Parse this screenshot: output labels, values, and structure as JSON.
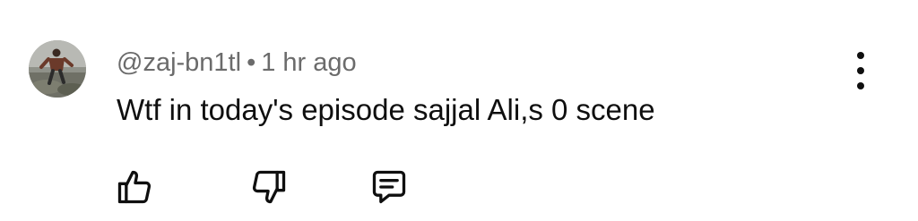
{
  "comment": {
    "author": "@zaj-bn1tl",
    "separator": "•",
    "time": "1 hr ago",
    "text": "Wtf in today's episode sajjal Ali,s 0 scene"
  },
  "icons": {
    "avatar": "avatar-photo",
    "more": "more-vertical-icon",
    "like": "thumbs-up-icon",
    "dislike": "thumbs-down-icon",
    "reply": "reply-comment-icon"
  }
}
